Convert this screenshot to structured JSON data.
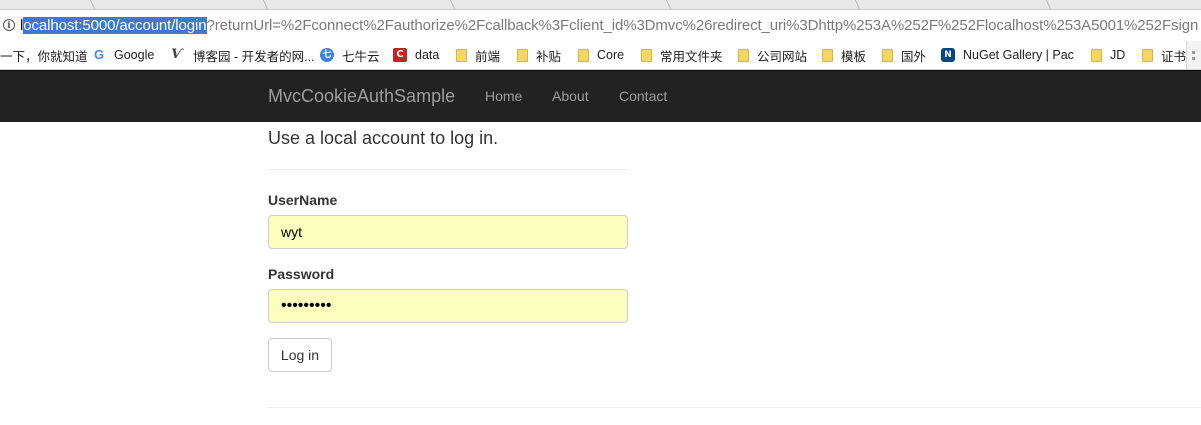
{
  "browser": {
    "url": {
      "prefix": "l",
      "selected": "ocalhost:5000/account/login",
      "rest": "?returnUrl=%2Fconnect%2Fauthorize%2Fcallback%3Fclient_id%3Dmvc%26redirect_uri%3Dhttp%253A%252F%252Flocalhost%253A5001%252Fsign"
    },
    "bookmarks": [
      {
        "label": "一下，你就知道",
        "icon": "none"
      },
      {
        "label": "Google",
        "icon": "google-icon"
      },
      {
        "label": "博客园 - 开发者的网...",
        "icon": "cnblogs-icon"
      },
      {
        "label": "七牛云",
        "icon": "qiniu-icon"
      },
      {
        "label": "data",
        "icon": "data-icon"
      },
      {
        "label": "前端",
        "icon": "folder-icon"
      },
      {
        "label": "补贴",
        "icon": "folder-icon"
      },
      {
        "label": "Core",
        "icon": "folder-icon"
      },
      {
        "label": "常用文件夹",
        "icon": "folder-icon"
      },
      {
        "label": "公司网站",
        "icon": "folder-icon"
      },
      {
        "label": "模板",
        "icon": "folder-icon"
      },
      {
        "label": "国外",
        "icon": "folder-icon"
      },
      {
        "label": "NuGet Gallery | Pac",
        "icon": "nuget-icon"
      },
      {
        "label": "JD",
        "icon": "folder-icon"
      },
      {
        "label": "证书",
        "icon": "folder-icon"
      }
    ]
  },
  "navbar": {
    "brand": "MvcCookieAuthSample",
    "links": [
      "Home",
      "About",
      "Contact"
    ]
  },
  "form": {
    "heading": "Use a local account to log in.",
    "username_label": "UserName",
    "username_value": "wyt",
    "password_label": "Password",
    "password_value": "•••••••••",
    "login_label": "Log in"
  },
  "colors": {
    "navbar_bg": "#222222",
    "autofill_bg": "#faffbd",
    "url_selection": "#3b78d8"
  }
}
